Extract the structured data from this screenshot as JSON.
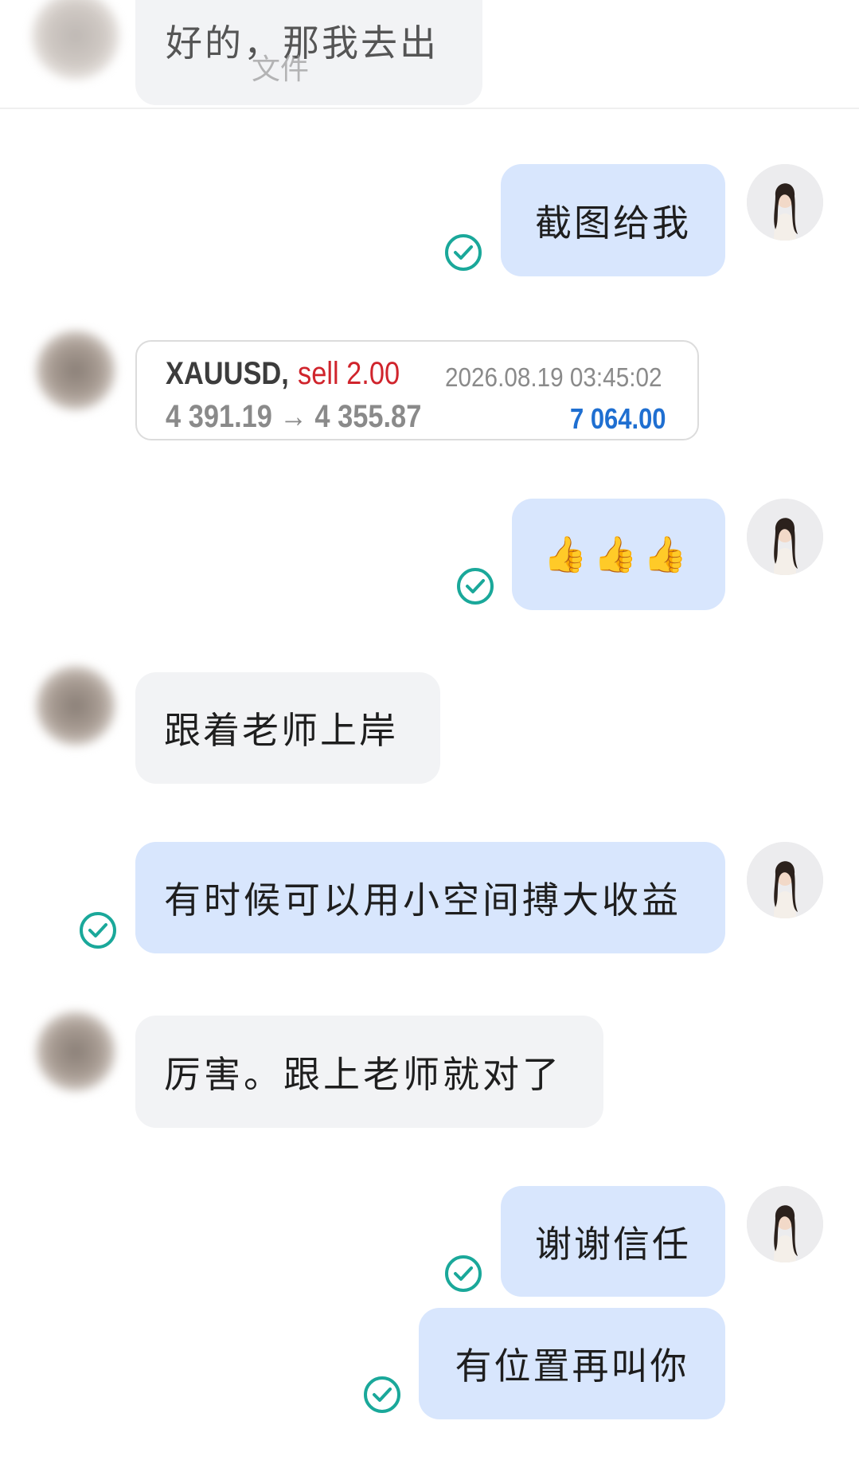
{
  "colors": {
    "outgoing_bubble": "#d8e6fd",
    "incoming_bubble": "#f2f3f5",
    "check_accent": "#1aa89a",
    "sell_red": "#d0242c",
    "profit_blue": "#1f6fd1"
  },
  "top_partial_message": {
    "text": "好的，那我去出",
    "overlay_text": "文件"
  },
  "messages": [
    {
      "direction": "out",
      "text": "截图给我",
      "status_icon": "check-circle-icon"
    },
    {
      "direction": "in",
      "type": "trade-card"
    },
    {
      "direction": "out",
      "text": "👍👍👍",
      "status_icon": "check-circle-icon"
    },
    {
      "direction": "in",
      "text": "跟着老师上岸"
    },
    {
      "direction": "out",
      "text": "有时候可以用小空间搏大收益",
      "status_icon": "check-circle-icon"
    },
    {
      "direction": "in",
      "text": "厉害。跟上老师就对了"
    },
    {
      "direction": "out",
      "text": "谢谢信任",
      "status_icon": "check-circle-icon"
    },
    {
      "direction": "out",
      "text": "有位置再叫你",
      "status_icon": "check-circle-icon"
    }
  ],
  "trade_card": {
    "symbol": "XAUUSD,",
    "side": "sell 2.00",
    "datetime": "2026.08.19 03:45:02",
    "prices": "4 391.19 → 4 355.87",
    "profit": "7 064.00"
  }
}
